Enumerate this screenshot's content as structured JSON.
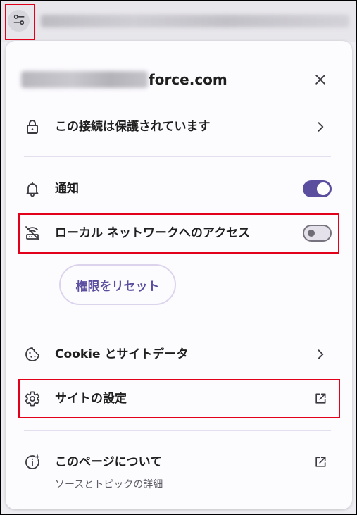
{
  "address_bar": {
    "site_info_icon": "tune-icon"
  },
  "site_info_popup": {
    "domain": "force.com",
    "close_icon": "close-icon",
    "connection": {
      "label": "この接続は保護されています",
      "icon": "lock-icon",
      "trailing_icon": "chevron-right-icon"
    },
    "permissions": [
      {
        "label": "通知",
        "icon": "bell-icon",
        "enabled": true
      },
      {
        "label": "ローカル ネットワークへのアクセス",
        "icon": "local-network-off-icon",
        "enabled": false
      }
    ],
    "reset_permissions_button": "権限をリセット",
    "cookies": {
      "label": "Cookie とサイトデータ",
      "icon": "cookie-icon",
      "trailing_icon": "chevron-right-icon"
    },
    "site_settings": {
      "label": "サイトの設定",
      "icon": "gear-icon",
      "trailing_icon": "external-link-icon"
    },
    "about_page": {
      "label": "このページについて",
      "sublabel": "ソースとトピックの詳細",
      "icon": "info-sparkle-icon",
      "trailing_icon": "external-link-icon"
    }
  },
  "colors": {
    "accent": "#5b4e9f",
    "highlight": "#e3001b",
    "text": "#1f1f1f",
    "secondary_text": "#5f5e66"
  }
}
